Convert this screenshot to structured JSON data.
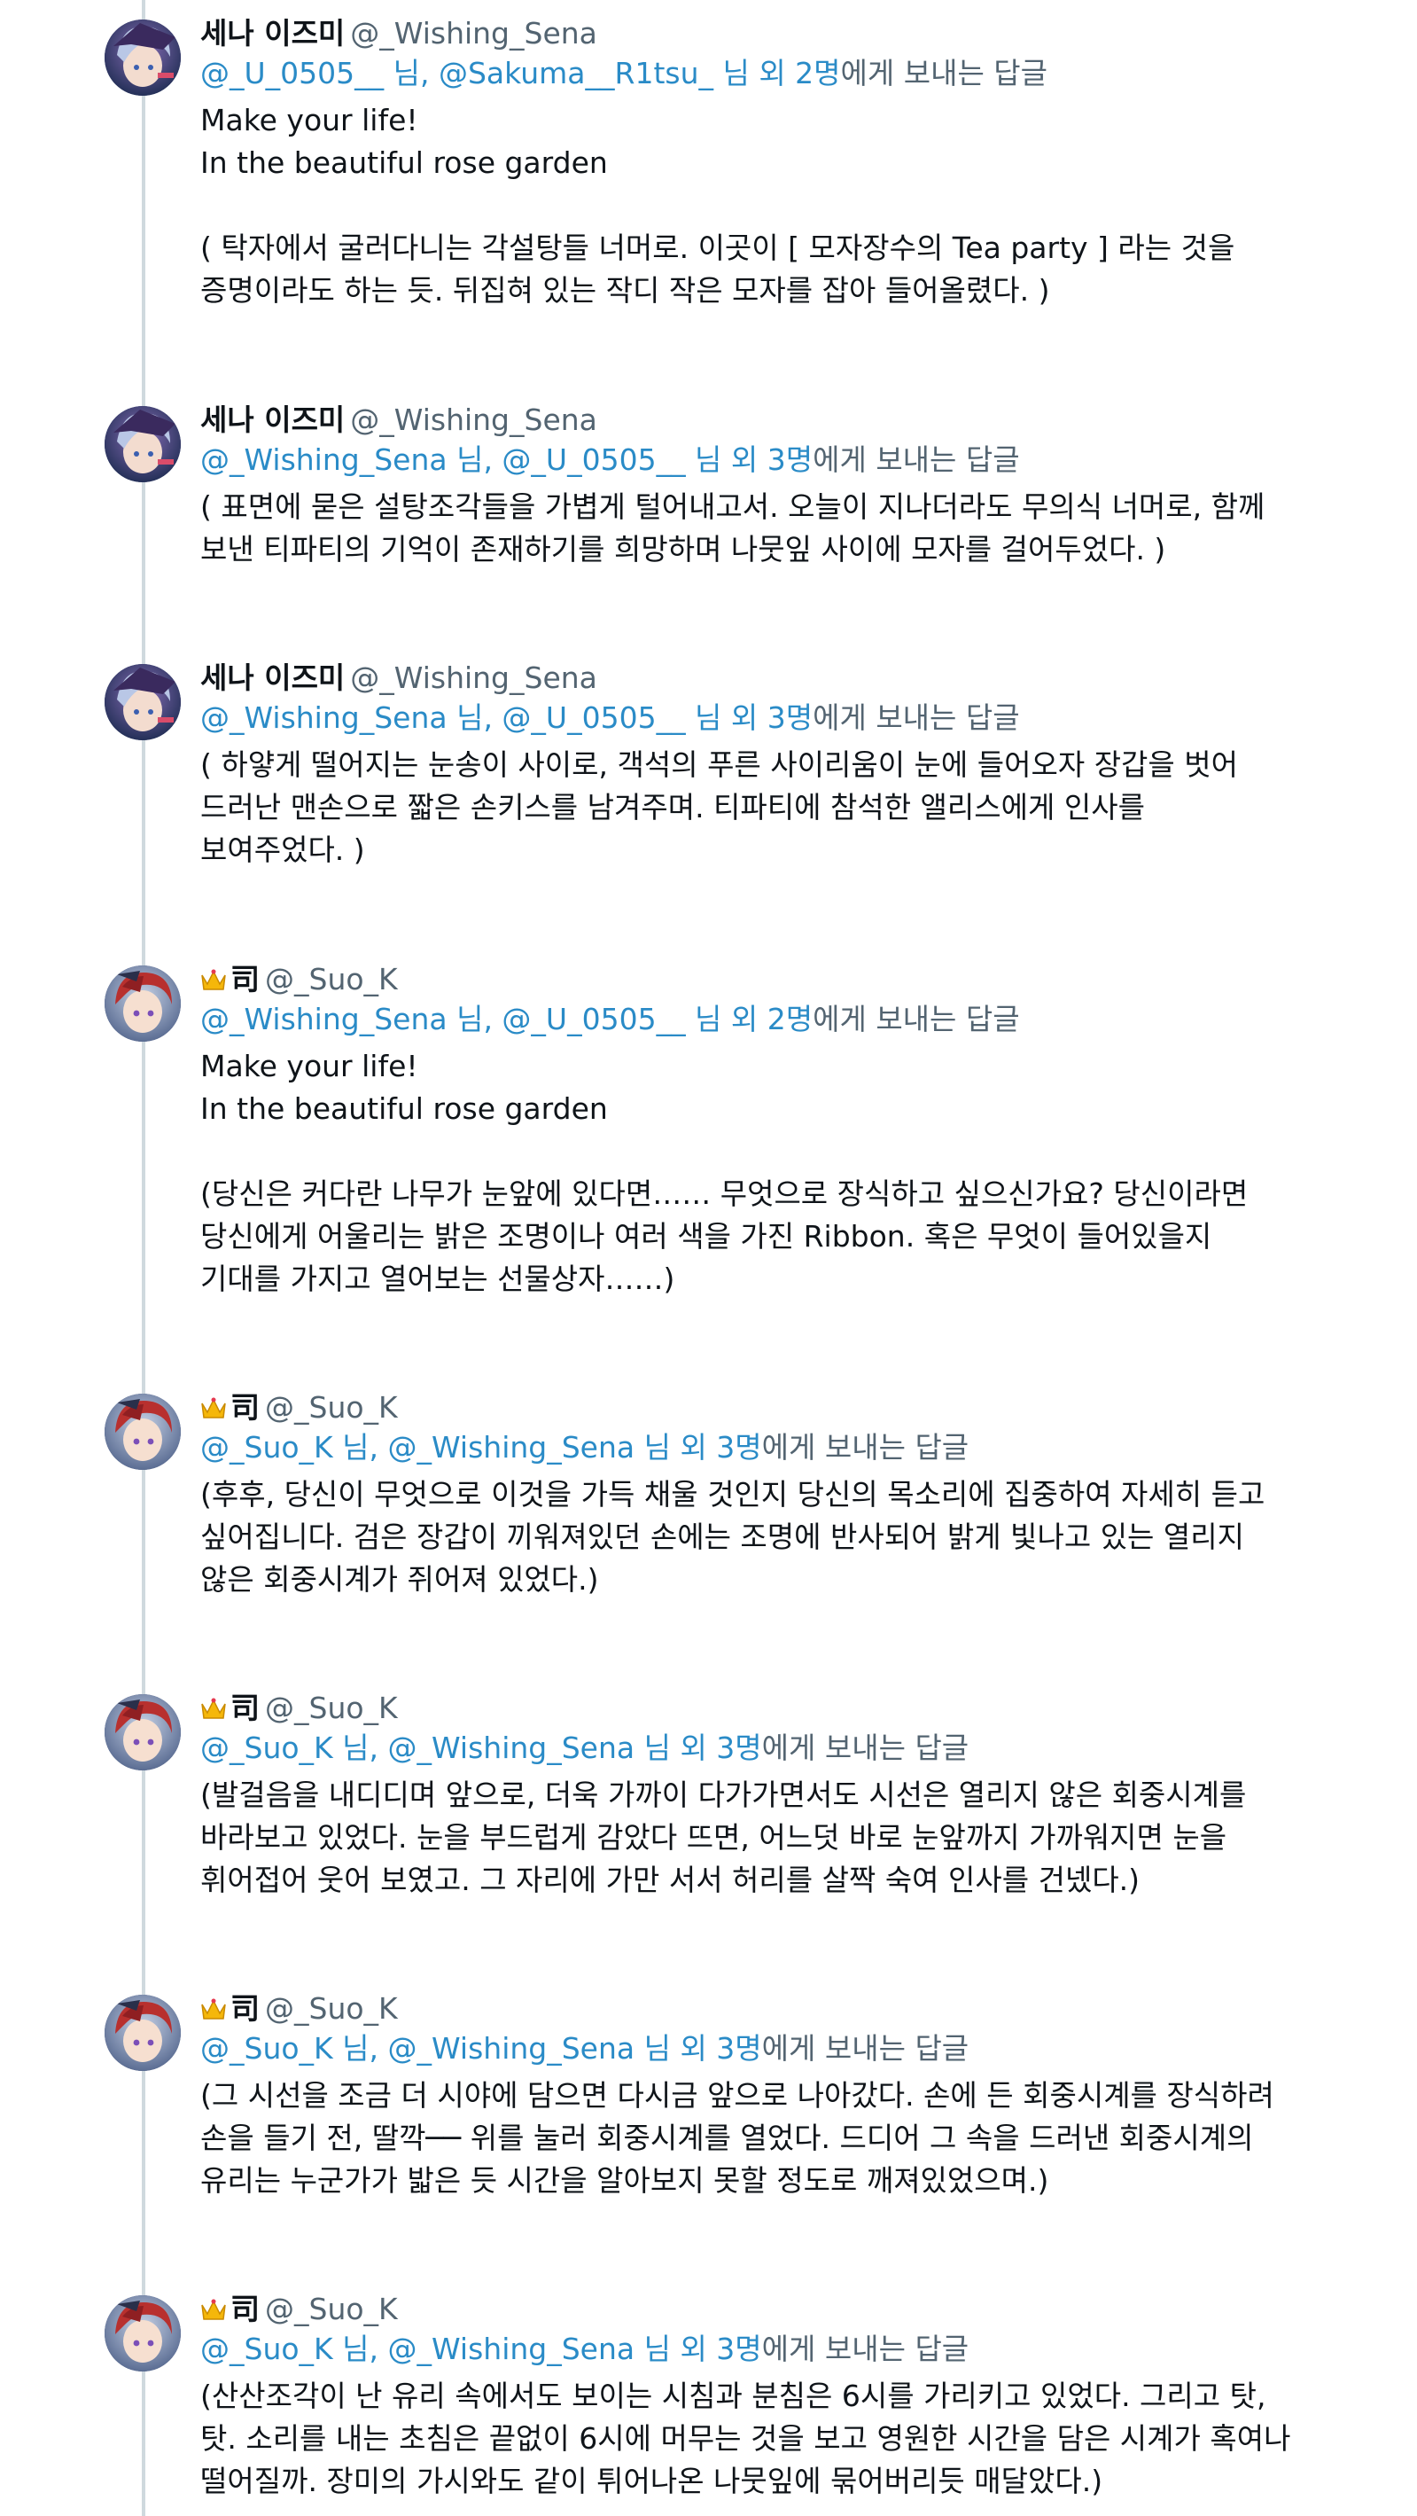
{
  "tweets": [
    {
      "avatar_icon": "sena-avatar-icon",
      "name": "세나 이즈미",
      "handle": "@_Wishing_Sena",
      "reply_users": "@_U_0505__ 님, @Sakuma__R1tsu_ 님 외 2명",
      "reply_suffix": "에게 보내는 답글",
      "lines": [
        "Make your life!",
        "In the beautiful rose garden",
        "",
        "( 탁자에서 굴러다니는 각설탕들 너머로. 이곳이 [ 모자장수의 Tea party ] 라는 것을\n증명이라도 하는 듯. 뒤집혀 있는 작디 작은 모자를 잡아 들어올렸다. )"
      ]
    },
    {
      "avatar_icon": "sena-avatar-icon",
      "name": "세나 이즈미",
      "handle": "@_Wishing_Sena",
      "reply_users": "@_Wishing_Sena 님, @_U_0505__ 님 외 3명",
      "reply_suffix": "에게 보내는 답글",
      "lines": [
        "( 표면에 묻은 설탕조각들을 가볍게 털어내고서. 오늘이 지나더라도 무의식 너머로, 함께\n보낸 티파티의 기억이 존재하기를 희망하며 나뭇잎 사이에 모자를 걸어두었다. )"
      ]
    },
    {
      "avatar_icon": "sena-avatar-icon",
      "name": "세나 이즈미",
      "handle": "@_Wishing_Sena",
      "reply_users": "@_Wishing_Sena 님, @_U_0505__ 님 외 3명",
      "reply_suffix": "에게 보내는 답글",
      "lines": [
        "( 하얗게 떨어지는 눈송이 사이로, 객석의 푸른 사이리움이 눈에 들어오자 장갑을 벗어\n드러난 맨손으로 짧은 손키스를 남겨주며. 티파티에 참석한 앨리스에게 인사를\n보여주었다. )"
      ]
    },
    {
      "avatar_icon": "suo-avatar-icon",
      "name": "司",
      "handle": "@_Suo_K",
      "reply_users": "@_Wishing_Sena 님, @_U_0505__ 님 외 2명",
      "reply_suffix": "에게 보내는 답글",
      "lines": [
        "Make your life!",
        "In the beautiful rose garden",
        "",
        "(당신은 커다란 나무가 눈앞에 있다면…… 무엇으로 장식하고 싶으신가요? 당신이라면\n당신에게 어울리는 밝은 조명이나 여러 색을 가진 Ribbon. 혹은 무엇이 들어있을지\n기대를 가지고 열어보는 선물상자……)"
      ]
    },
    {
      "avatar_icon": "suo-avatar-icon",
      "name": "司",
      "handle": "@_Suo_K",
      "reply_users": "@_Suo_K 님, @_Wishing_Sena 님 외 3명",
      "reply_suffix": "에게 보내는 답글",
      "lines": [
        "(후후, 당신이 무엇으로 이것을 가득 채울 것인지 당신의 목소리에 집중하여 자세히 듣고\n싶어집니다. 검은 장갑이 끼워져있던 손에는 조명에 반사되어 밝게 빛나고 있는 열리지\n않은 회중시계가 쥐어져 있었다.)"
      ]
    },
    {
      "avatar_icon": "suo-avatar-icon",
      "name": "司",
      "handle": "@_Suo_K",
      "reply_users": "@_Suo_K 님, @_Wishing_Sena 님 외 3명",
      "reply_suffix": "에게 보내는 답글",
      "lines": [
        "(발걸음을 내디디며 앞으로, 더욱 가까이 다가가면서도 시선은 열리지 않은 회중시계를\n바라보고 있었다. 눈을 부드럽게 감았다 뜨면, 어느덧 바로 눈앞까지 가까워지면 눈을\n휘어접어 웃어 보였고. 그 자리에 가만 서서 허리를 살짝 숙여 인사를 건넸다.)"
      ]
    },
    {
      "avatar_icon": "suo-avatar-icon",
      "name": "司",
      "handle": "@_Suo_K",
      "reply_users": "@_Suo_K 님, @_Wishing_Sena 님 외 3명",
      "reply_suffix": "에게 보내는 답글",
      "lines": [
        "(그 시선을 조금 더 시야에 담으면 다시금 앞으로 나아갔다. 손에 든 회중시계를 장식하려\n손을 들기 전, 딸깍── 위를 눌러 회중시계를 열었다. 드디어 그 속을 드러낸 회중시계의\n유리는 누군가가 밟은 듯 시간을 알아보지 못할 정도로 깨져있었으며.)"
      ]
    },
    {
      "avatar_icon": "suo-avatar-icon",
      "name": "司",
      "handle": "@_Suo_K",
      "reply_users": "@_Suo_K 님, @_Wishing_Sena 님 외 3명",
      "reply_suffix": "에게 보내는 답글",
      "lines": [
        "(산산조각이 난 유리 속에서도 보이는 시침과 분침은 6시를 가리키고 있었다. 그리고 탓,\n탓. 소리를 내는 초침은 끝없이 6시에 머무는 것을 보고 영원한 시간을 담은 시계가 혹여나\n떨어질까. 장미의 가시와도 같이 튀어나온 나뭇잎에 묶어버리듯 매달았다.)"
      ]
    }
  ],
  "colors": {
    "link": "#2a8bc7",
    "muted": "#536471",
    "text": "#0f1419",
    "thread_line": "#cfd9de"
  }
}
